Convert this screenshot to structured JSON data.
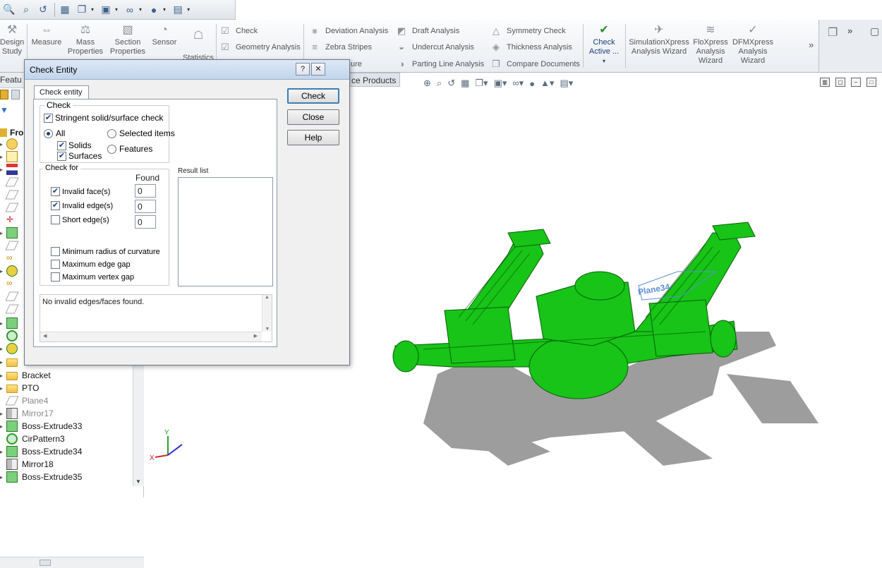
{
  "top_toolbar": {
    "icons": [
      "zoom-fit-icon",
      "zoom-area-icon",
      "previous-view-icon",
      "section-view-icon",
      "view-orientation-icon",
      "display-style-icon",
      "hide-show-icon",
      "appearance-icon",
      "scene-icon"
    ]
  },
  "cmd_manager": {
    "design_study": "Design Study",
    "measure": "Measure",
    "mass_properties": "Mass Properties",
    "section_properties": "Section Properties",
    "sensor": "Sensor",
    "statistics": "Statistics",
    "check": "Check",
    "geometry_analysis": "Geometry Analysis",
    "deviation_analysis": "Deviation Analysis",
    "zebra_stripes": "Zebra Stripes",
    "curvature": "ure",
    "draft_analysis": "Draft Analysis",
    "undercut_analysis": "Undercut Analysis",
    "parting_line_analysis": "Parting Line Analysis",
    "symmetry_check": "Symmetry Check",
    "thickness_analysis": "Thickness Analysis",
    "compare_documents": "Compare Documents",
    "check_active": "Check Active ...",
    "simulationxpress": "SimulationXpress Analysis Wizard",
    "floxpress": "FloXpress Analysis Wizard",
    "dfmxpress": "DFMXpress Analysis Wizard",
    "more": "»"
  },
  "feature_tree": {
    "tab_label": "Featu",
    "root": "Fron",
    "items": [
      {
        "label": "Bracket",
        "icon": "folder"
      },
      {
        "label": "PTO",
        "icon": "folder"
      },
      {
        "label": "Plane4",
        "icon": "plane"
      },
      {
        "label": "Mirror17",
        "icon": "mirror"
      },
      {
        "label": "Boss-Extrude33",
        "icon": "boss"
      },
      {
        "label": "CirPattern3",
        "icon": "pattern"
      },
      {
        "label": "Boss-Extrude34",
        "icon": "boss"
      },
      {
        "label": "Mirror18",
        "icon": "mirror"
      },
      {
        "label": "Boss-Extrude35",
        "icon": "boss"
      }
    ]
  },
  "viewport": {
    "products_tab": "ce Products",
    "plane_label": "Plane34",
    "axis_labels": {
      "y": "Y",
      "x": "X"
    }
  },
  "dialog": {
    "title": "Check Entity",
    "help_btn": "?",
    "close_btn": "X",
    "tab": "Check entity",
    "check_group": "Check",
    "stringent": "Stringent solid/surface check",
    "all": "All",
    "selected_items": "Selected items",
    "solids": "Solids",
    "surfaces": "Surfaces",
    "features": "Features",
    "check_for": "Check for",
    "found": "Found",
    "invalid_faces": "Invalid face(s)",
    "invalid_edges": "Invalid edge(s)",
    "short_edges": "Short edge(s)",
    "found_faces": "0",
    "found_edges": "0",
    "found_short": "0",
    "min_radius": "Minimum radius of curvature",
    "max_edge_gap": "Maximum edge gap",
    "max_vertex_gap": "Maximum vertex gap",
    "result_list": "Result list",
    "status": "No invalid edges/faces found.",
    "btn_check": "Check",
    "btn_close": "Close",
    "btn_help": "Help"
  },
  "colors": {
    "model_green": "#17c417",
    "model_shadow": "#8c8c8c",
    "accent_blue": "#3c7fb1"
  }
}
